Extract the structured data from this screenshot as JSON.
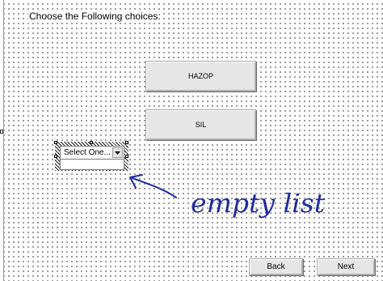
{
  "prompt": {
    "text": "Choose the Following choices:"
  },
  "buttons": {
    "hazop": "HAZOP",
    "sil": "SIL",
    "back": "Back",
    "next": "Next"
  },
  "combo": {
    "selected": "Select One...",
    "list_items": []
  },
  "annotation": {
    "text": "empty list",
    "color": "#1f2b9e"
  },
  "icons": {
    "combo_arrow": "chevron-down-icon",
    "annotation_arrow": "arrow-icon"
  }
}
